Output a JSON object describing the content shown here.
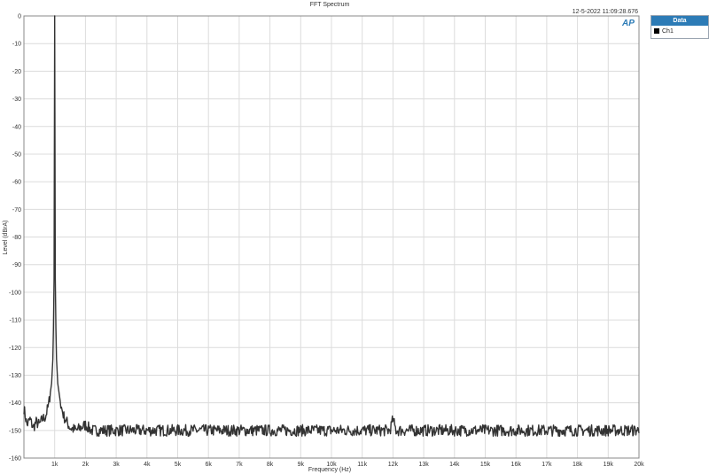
{
  "chart_data": {
    "type": "line",
    "title": "FFT Spectrum",
    "timestamp": "12-5-2022 11:09:28.676",
    "xlabel": "Frequency (Hz)",
    "ylabel": "Level (dBrA)",
    "xlim": [
      0,
      20000
    ],
    "ylim": [
      -160,
      0
    ],
    "x_ticks": [
      {
        "value": 1000,
        "label": "1k"
      },
      {
        "value": 2000,
        "label": "2k"
      },
      {
        "value": 3000,
        "label": "3k"
      },
      {
        "value": 4000,
        "label": "4k"
      },
      {
        "value": 5000,
        "label": "5k"
      },
      {
        "value": 6000,
        "label": "6k"
      },
      {
        "value": 7000,
        "label": "7k"
      },
      {
        "value": 8000,
        "label": "8k"
      },
      {
        "value": 9000,
        "label": "9k"
      },
      {
        "value": 10000,
        "label": "10k"
      },
      {
        "value": 11000,
        "label": "11k"
      },
      {
        "value": 12000,
        "label": "12k"
      },
      {
        "value": 13000,
        "label": "13k"
      },
      {
        "value": 14000,
        "label": "14k"
      },
      {
        "value": 15000,
        "label": "15k"
      },
      {
        "value": 16000,
        "label": "16k"
      },
      {
        "value": 17000,
        "label": "17k"
      },
      {
        "value": 18000,
        "label": "18k"
      },
      {
        "value": 19000,
        "label": "19k"
      },
      {
        "value": 20000,
        "label": "20k"
      }
    ],
    "y_ticks": [
      0,
      -10,
      -20,
      -30,
      -40,
      -50,
      -60,
      -70,
      -80,
      -90,
      -100,
      -110,
      -120,
      -130,
      -140,
      -150,
      -160
    ],
    "grid": true,
    "legend_position": "top-right",
    "legend_title": "Data",
    "series": [
      {
        "name": "Ch1",
        "color": "#333333",
        "points": [
          [
            0,
            -142
          ],
          [
            100,
            -148
          ],
          [
            200,
            -146
          ],
          [
            300,
            -149
          ],
          [
            400,
            -147
          ],
          [
            500,
            -148
          ],
          [
            600,
            -146
          ],
          [
            700,
            -145
          ],
          [
            800,
            -141
          ],
          [
            900,
            -133
          ],
          [
            950,
            -122
          ],
          [
            980,
            -95
          ],
          [
            1000,
            0
          ],
          [
            1020,
            -95
          ],
          [
            1050,
            -122
          ],
          [
            1100,
            -133
          ],
          [
            1200,
            -141
          ],
          [
            1300,
            -145
          ],
          [
            1400,
            -147
          ],
          [
            1500,
            -149
          ],
          [
            1700,
            -150
          ],
          [
            2000,
            -148
          ],
          [
            2200,
            -150
          ],
          [
            3000,
            -150
          ],
          [
            4000,
            -150
          ],
          [
            5000,
            -150
          ],
          [
            6000,
            -150
          ],
          [
            7000,
            -150
          ],
          [
            8000,
            -150
          ],
          [
            9000,
            -150
          ],
          [
            10000,
            -150
          ],
          [
            11000,
            -150
          ],
          [
            11900,
            -150
          ],
          [
            12000,
            -146
          ],
          [
            12100,
            -150
          ],
          [
            13000,
            -150
          ],
          [
            14000,
            -150
          ],
          [
            15000,
            -150
          ],
          [
            16000,
            -150
          ],
          [
            17000,
            -150
          ],
          [
            18000,
            -150
          ],
          [
            19000,
            -150
          ],
          [
            20000,
            -150
          ]
        ],
        "noise_floor": -150
      }
    ]
  },
  "logo_text": "AP"
}
